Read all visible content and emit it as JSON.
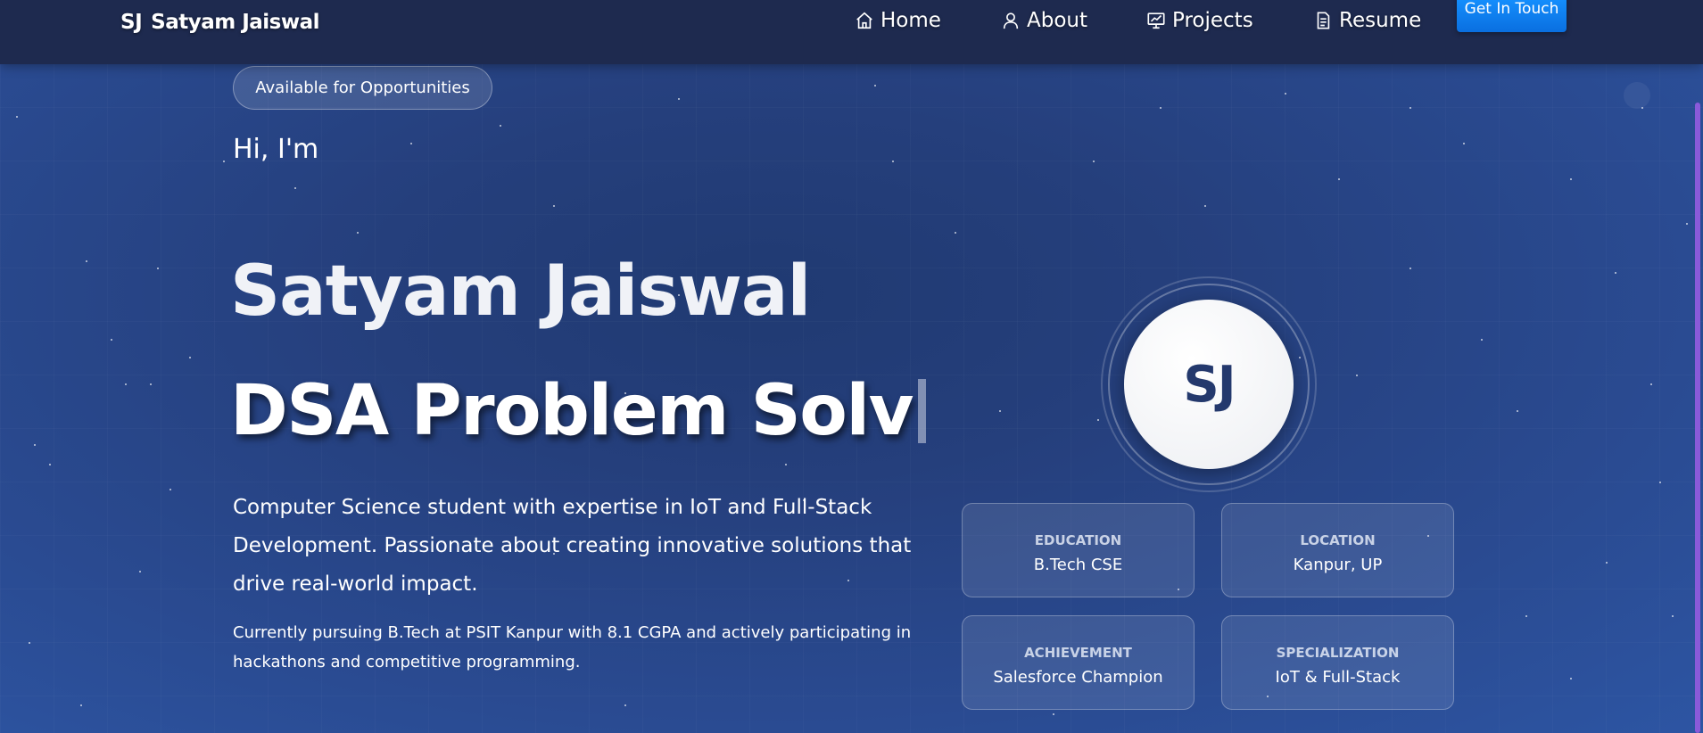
{
  "nav": {
    "brand_initials": "SJ",
    "brand_name": "Satyam Jaiswal",
    "links": [
      {
        "label": "Home",
        "icon": "home-icon"
      },
      {
        "label": "About",
        "icon": "user-icon"
      },
      {
        "label": "Projects",
        "icon": "presentation-icon"
      },
      {
        "label": "Resume",
        "icon": "document-icon"
      }
    ],
    "cta_label": "Get In Touch"
  },
  "hero": {
    "badge": "Available for Opportunities",
    "greeting": "Hi, I'm",
    "name": "Satyam Jaiswal",
    "typed_role": "DSA Problem Solv",
    "description": "Computer Science student with expertise in IoT and Full-Stack Development. Passionate about creating innovative solutions that drive real-world impact.",
    "sub_description": "Currently pursuing B.Tech at PSIT Kanpur with 8.1 CGPA and actively participating in hackathons and competitive programming."
  },
  "profile": {
    "avatar_initials": "SJ",
    "cards": [
      {
        "label": "EDUCATION",
        "value": "B.Tech CSE"
      },
      {
        "label": "LOCATION",
        "value": "Kanpur, UP"
      },
      {
        "label": "ACHIEVEMENT",
        "value": "Salesforce Champion"
      },
      {
        "label": "SPECIALIZATION",
        "value": "IoT & Full-Stack"
      }
    ]
  },
  "colors": {
    "nav_bg": "#1e2a4f",
    "hero_bg": "#2a4b92",
    "cta": "#0a7cf0",
    "avatar_text": "#24396d",
    "scrollbar": "#8a5ad9"
  }
}
